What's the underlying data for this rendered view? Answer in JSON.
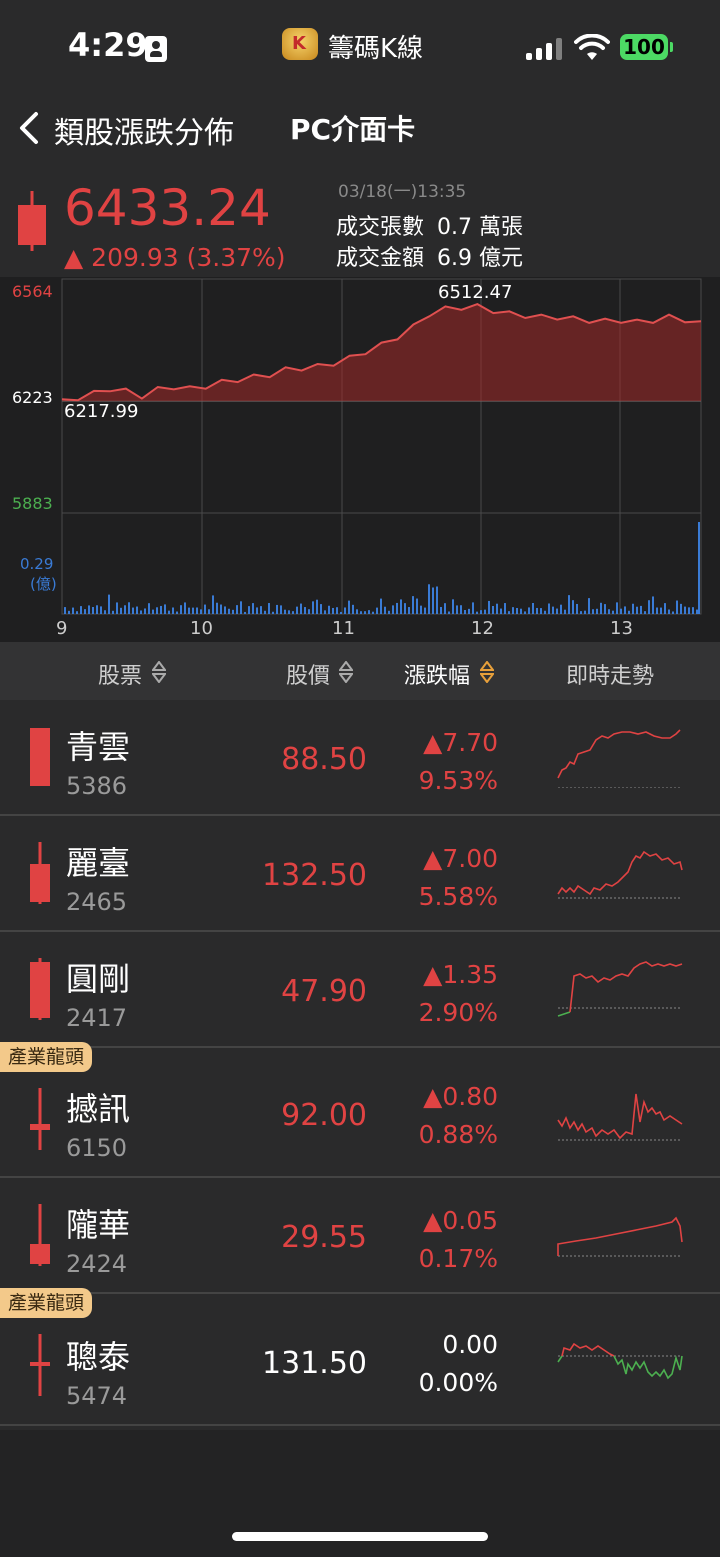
{
  "status_bar": {
    "time": "4:29",
    "app_name": "籌碼K線",
    "app_logo_letter": "K",
    "battery": "100"
  },
  "nav": {
    "title": "類股漲跌分佈",
    "subtitle": "PC介面卡"
  },
  "summary": {
    "price": "6433.24",
    "change": "▲ 209.93 (3.37%)",
    "datetime": "03/18(一)13:35",
    "volume_label": "成交張數",
    "volume_value": "0.7 萬張",
    "amount_label": "成交金額",
    "amount_value": "6.9 億元"
  },
  "chart_data": {
    "type": "line",
    "y_ticks": [
      "6564",
      "6223",
      "5883"
    ],
    "volume_tick": "0.29",
    "volume_unit": "(億)",
    "x_ticks": [
      "9",
      "10",
      "11",
      "12",
      "13"
    ],
    "high_label": "6512.47",
    "low_label": "6217.99",
    "ylim": [
      5883,
      6564
    ],
    "reference": 6223,
    "price_series": [
      6223,
      6235,
      6248,
      6262,
      6255,
      6240,
      6260,
      6268,
      6262,
      6270,
      6282,
      6290,
      6298,
      6305,
      6320,
      6325,
      6330,
      6340,
      6355,
      6375,
      6395,
      6420,
      6450,
      6490,
      6505,
      6510,
      6512,
      6500,
      6490,
      6485,
      6480,
      6480,
      6475,
      6470,
      6468,
      6470,
      6465,
      6470,
      6480,
      6472,
      6460
    ]
  },
  "table": {
    "headers": {
      "stock": "股票",
      "price": "股價",
      "change": "漲跌幅",
      "trend": "即時走勢"
    },
    "rows": [
      {
        "name": "青雲",
        "code": "5386",
        "price": "88.50",
        "chg": "▲7.70",
        "pct": "9.53%",
        "tag": ""
      },
      {
        "name": "麗臺",
        "code": "2465",
        "price": "132.50",
        "chg": "▲7.00",
        "pct": "5.58%",
        "tag": ""
      },
      {
        "name": "圓剛",
        "code": "2417",
        "price": "47.90",
        "chg": "▲1.35",
        "pct": "2.90%",
        "tag": ""
      },
      {
        "name": "撼訊",
        "code": "6150",
        "price": "92.00",
        "chg": "▲0.80",
        "pct": "0.88%",
        "tag": "產業龍頭"
      },
      {
        "name": "隴華",
        "code": "2424",
        "price": "29.55",
        "chg": "▲0.05",
        "pct": "0.17%",
        "tag": ""
      },
      {
        "name": "聰泰",
        "code": "5474",
        "price": "131.50",
        "chg": "0.00",
        "pct": "0.00%",
        "tag": "產業龍頭"
      }
    ]
  },
  "colors": {
    "up": "#e04343",
    "down": "#4caf50",
    "bg": "#2a2a2b",
    "volume": "#3a7bd5",
    "tag": "#f3c98a"
  }
}
